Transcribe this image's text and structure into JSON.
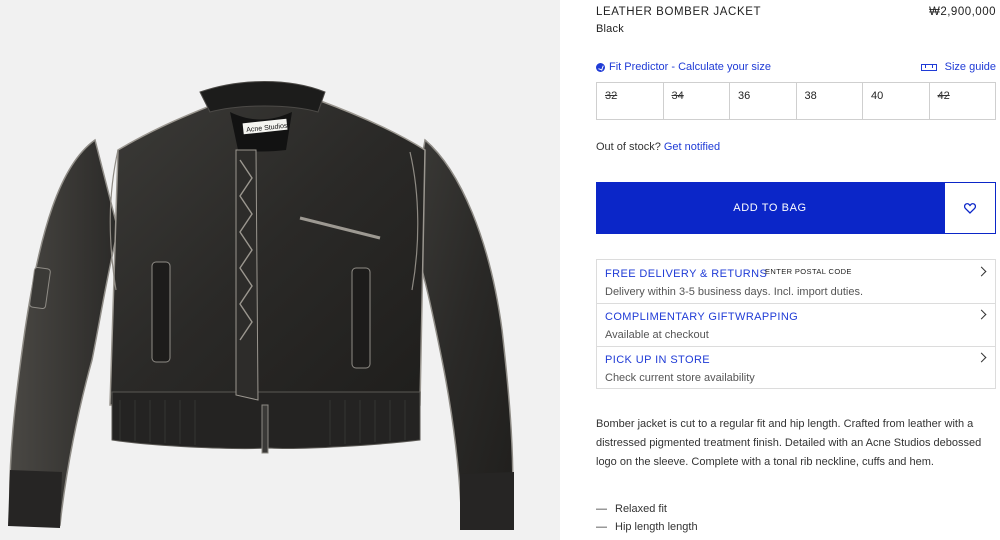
{
  "product": {
    "title": "LEATHER BOMBER JACKET",
    "price": "₩2,900,000",
    "color": "Black",
    "label_text": "Acne Studios"
  },
  "fit": {
    "predictor_label": "Fit Predictor - Calculate your size",
    "size_guide_label": "Size guide"
  },
  "sizes": [
    {
      "label": "32",
      "available": false
    },
    {
      "label": "34",
      "available": false
    },
    {
      "label": "36",
      "available": true
    },
    {
      "label": "38",
      "available": true
    },
    {
      "label": "40",
      "available": true
    },
    {
      "label": "42",
      "available": false
    }
  ],
  "stock": {
    "question": "Out of stock?",
    "notify_link": "Get notified"
  },
  "cta": {
    "add_to_bag": "ADD TO BAG",
    "wishlist_icon": "heart-icon"
  },
  "info": [
    {
      "title": "FREE DELIVERY & RETURNS",
      "extra": "ENTER POSTAL CODE",
      "subtitle": "Delivery within 3-5 business days. Incl. import duties."
    },
    {
      "title": "COMPLIMENTARY GIFTWRAPPING",
      "subtitle": "Available at checkout"
    },
    {
      "title": "PICK UP IN STORE",
      "subtitle": "Check current store availability"
    }
  ],
  "description": "Bomber jacket is cut to a regular fit and hip length. Crafted from leather with a distressed pigmented treatment finish. Detailed with an Acne Studios debossed logo on the sleeve. Complete with a tonal rib neckline, cuffs and hem.",
  "features": [
    "Relaxed fit",
    "Hip length length"
  ],
  "colors": {
    "accent": "#0b26c8",
    "link": "#1f3bd6",
    "image_bg": "#f1f1f1"
  }
}
